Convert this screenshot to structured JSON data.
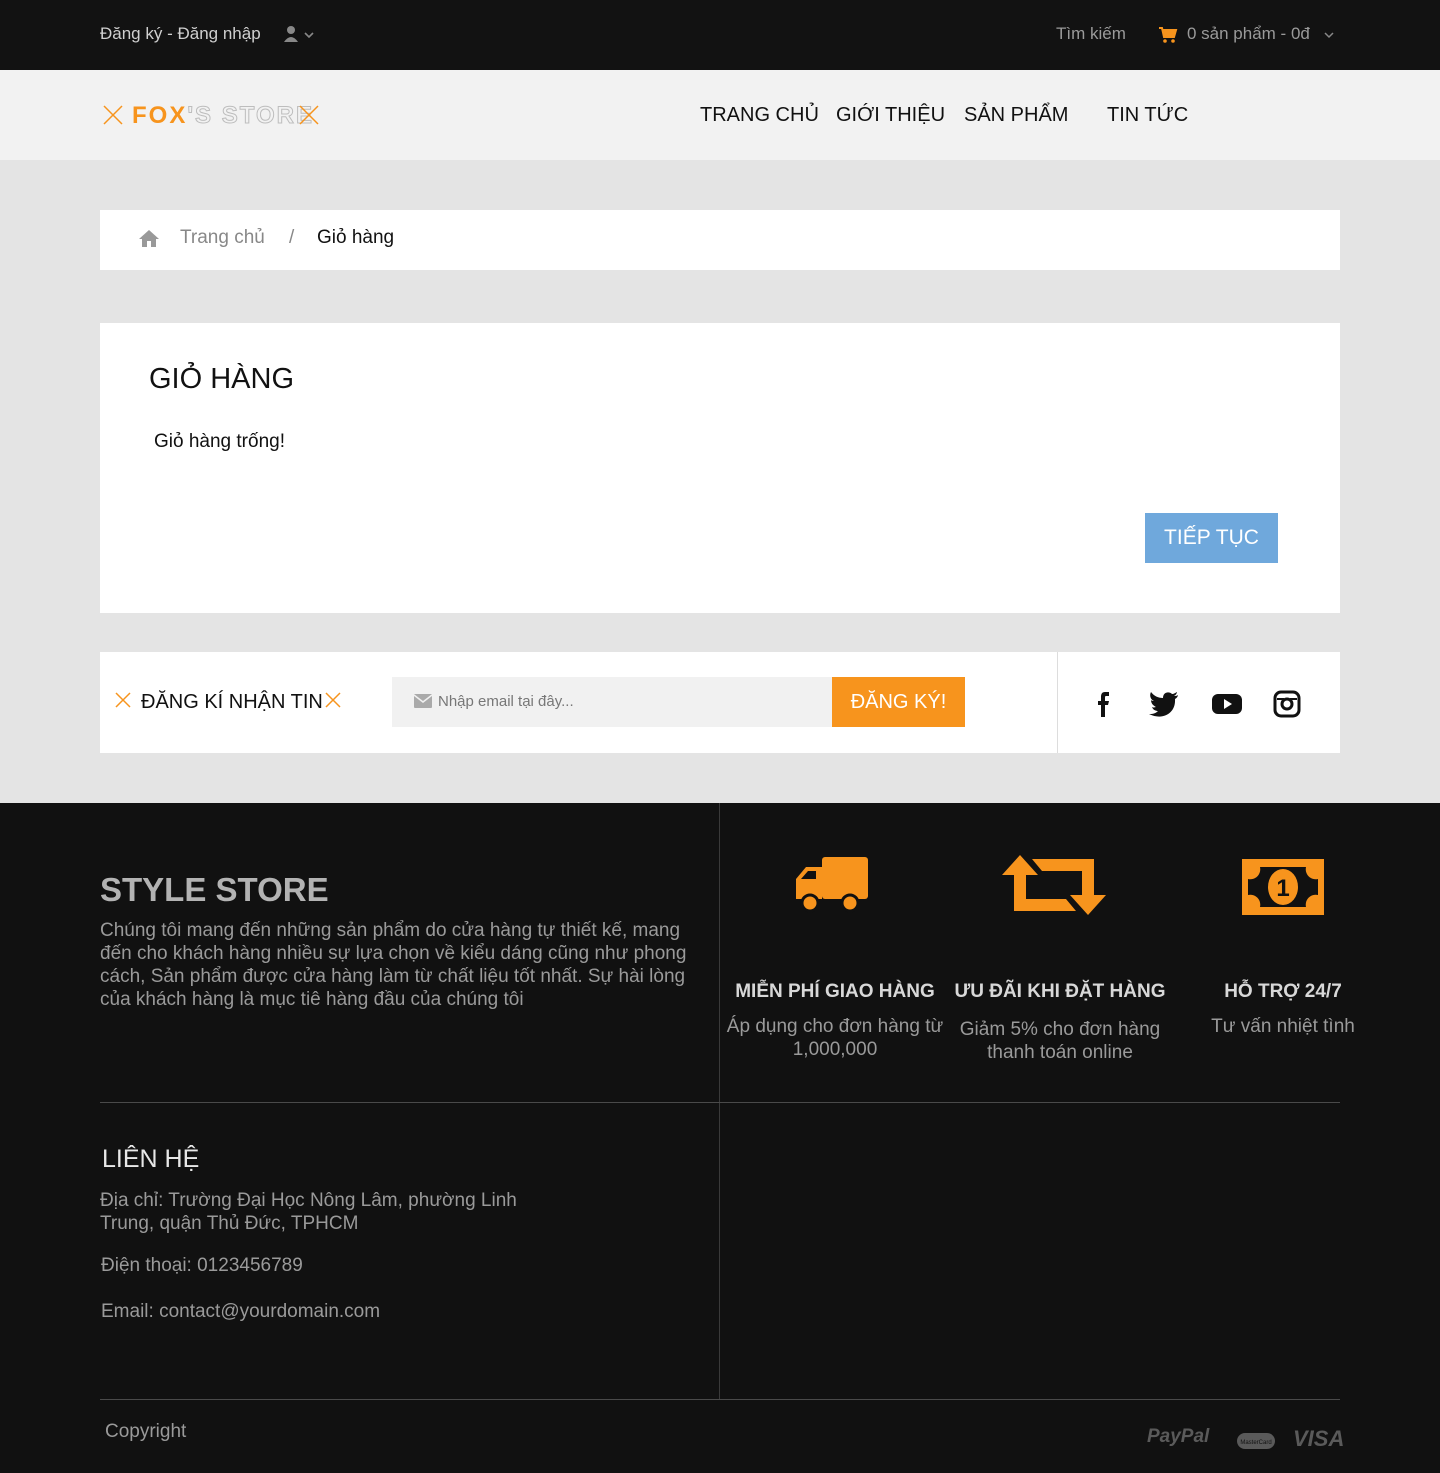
{
  "topbar": {
    "auth_label": "Đăng ký - Đăng nhập",
    "search_label": "Tìm kiếm",
    "cart_summary": "0 sản phẩm - 0đ"
  },
  "header": {
    "logo_part1": "FOX",
    "logo_part2": "'S STORE",
    "nav": [
      "TRANG CHỦ",
      "GIỚI THIỆU",
      "SẢN PHẨM",
      "TIN TỨC"
    ]
  },
  "breadcrumb": {
    "home": "Trang chủ",
    "separator": "/",
    "current": "Giỏ hàng"
  },
  "cart": {
    "title": "GIỎ HÀNG",
    "empty_message": "Giỏ hàng trống!",
    "continue_button": "TIẾP TỤC"
  },
  "newsletter": {
    "label": "ĐĂNG KÍ NHẬN TIN",
    "placeholder": "Nhập email tại đây...",
    "submit": "ĐĂNG KÝ!"
  },
  "social": [
    "facebook-icon",
    "twitter-icon",
    "youtube-icon",
    "instagram-icon"
  ],
  "footer": {
    "store_title": "STYLE STORE",
    "store_desc": "Chúng tôi mang đến những sản phẩm do cửa hàng tự thiết kế, mang đến cho khách hàng nhiều sự lựa chọn về kiểu dáng cũng như phong cách, Sản phẩm được cửa hàng làm từ chất liệu tốt nhất. Sự hài lòng của khách hàng là mục tiê hàng đầu của chúng tôi",
    "features": [
      {
        "icon": "truck-icon",
        "title": "MIỄN PHÍ GIAO HÀNG",
        "desc": "Áp dụng cho đơn hàng từ 1,000,000"
      },
      {
        "icon": "retweet-icon",
        "title": "ƯU ĐÃI KHI ĐẶT HÀNG",
        "desc": "Giảm 5% cho đơn hàng thanh toán online"
      },
      {
        "icon": "money-icon",
        "title": "HỖ TRỢ 24/7",
        "desc": "Tư vấn nhiệt tình"
      }
    ],
    "contact_title": "LIÊN HỆ",
    "address": "Địa chỉ: Trường Đại Học Nông Lâm, phường Linh Trung, quận Thủ Đức, TPHCM",
    "phone": "Điện thoại: 0123456789",
    "email": "Email: contact@yourdomain.com",
    "copyright": "Copyright",
    "payments": [
      "PayPal",
      "MasterCard",
      "VISA"
    ]
  },
  "colors": {
    "accent": "#f7941d",
    "button_blue": "#6fa8dc",
    "dark": "#111111"
  }
}
